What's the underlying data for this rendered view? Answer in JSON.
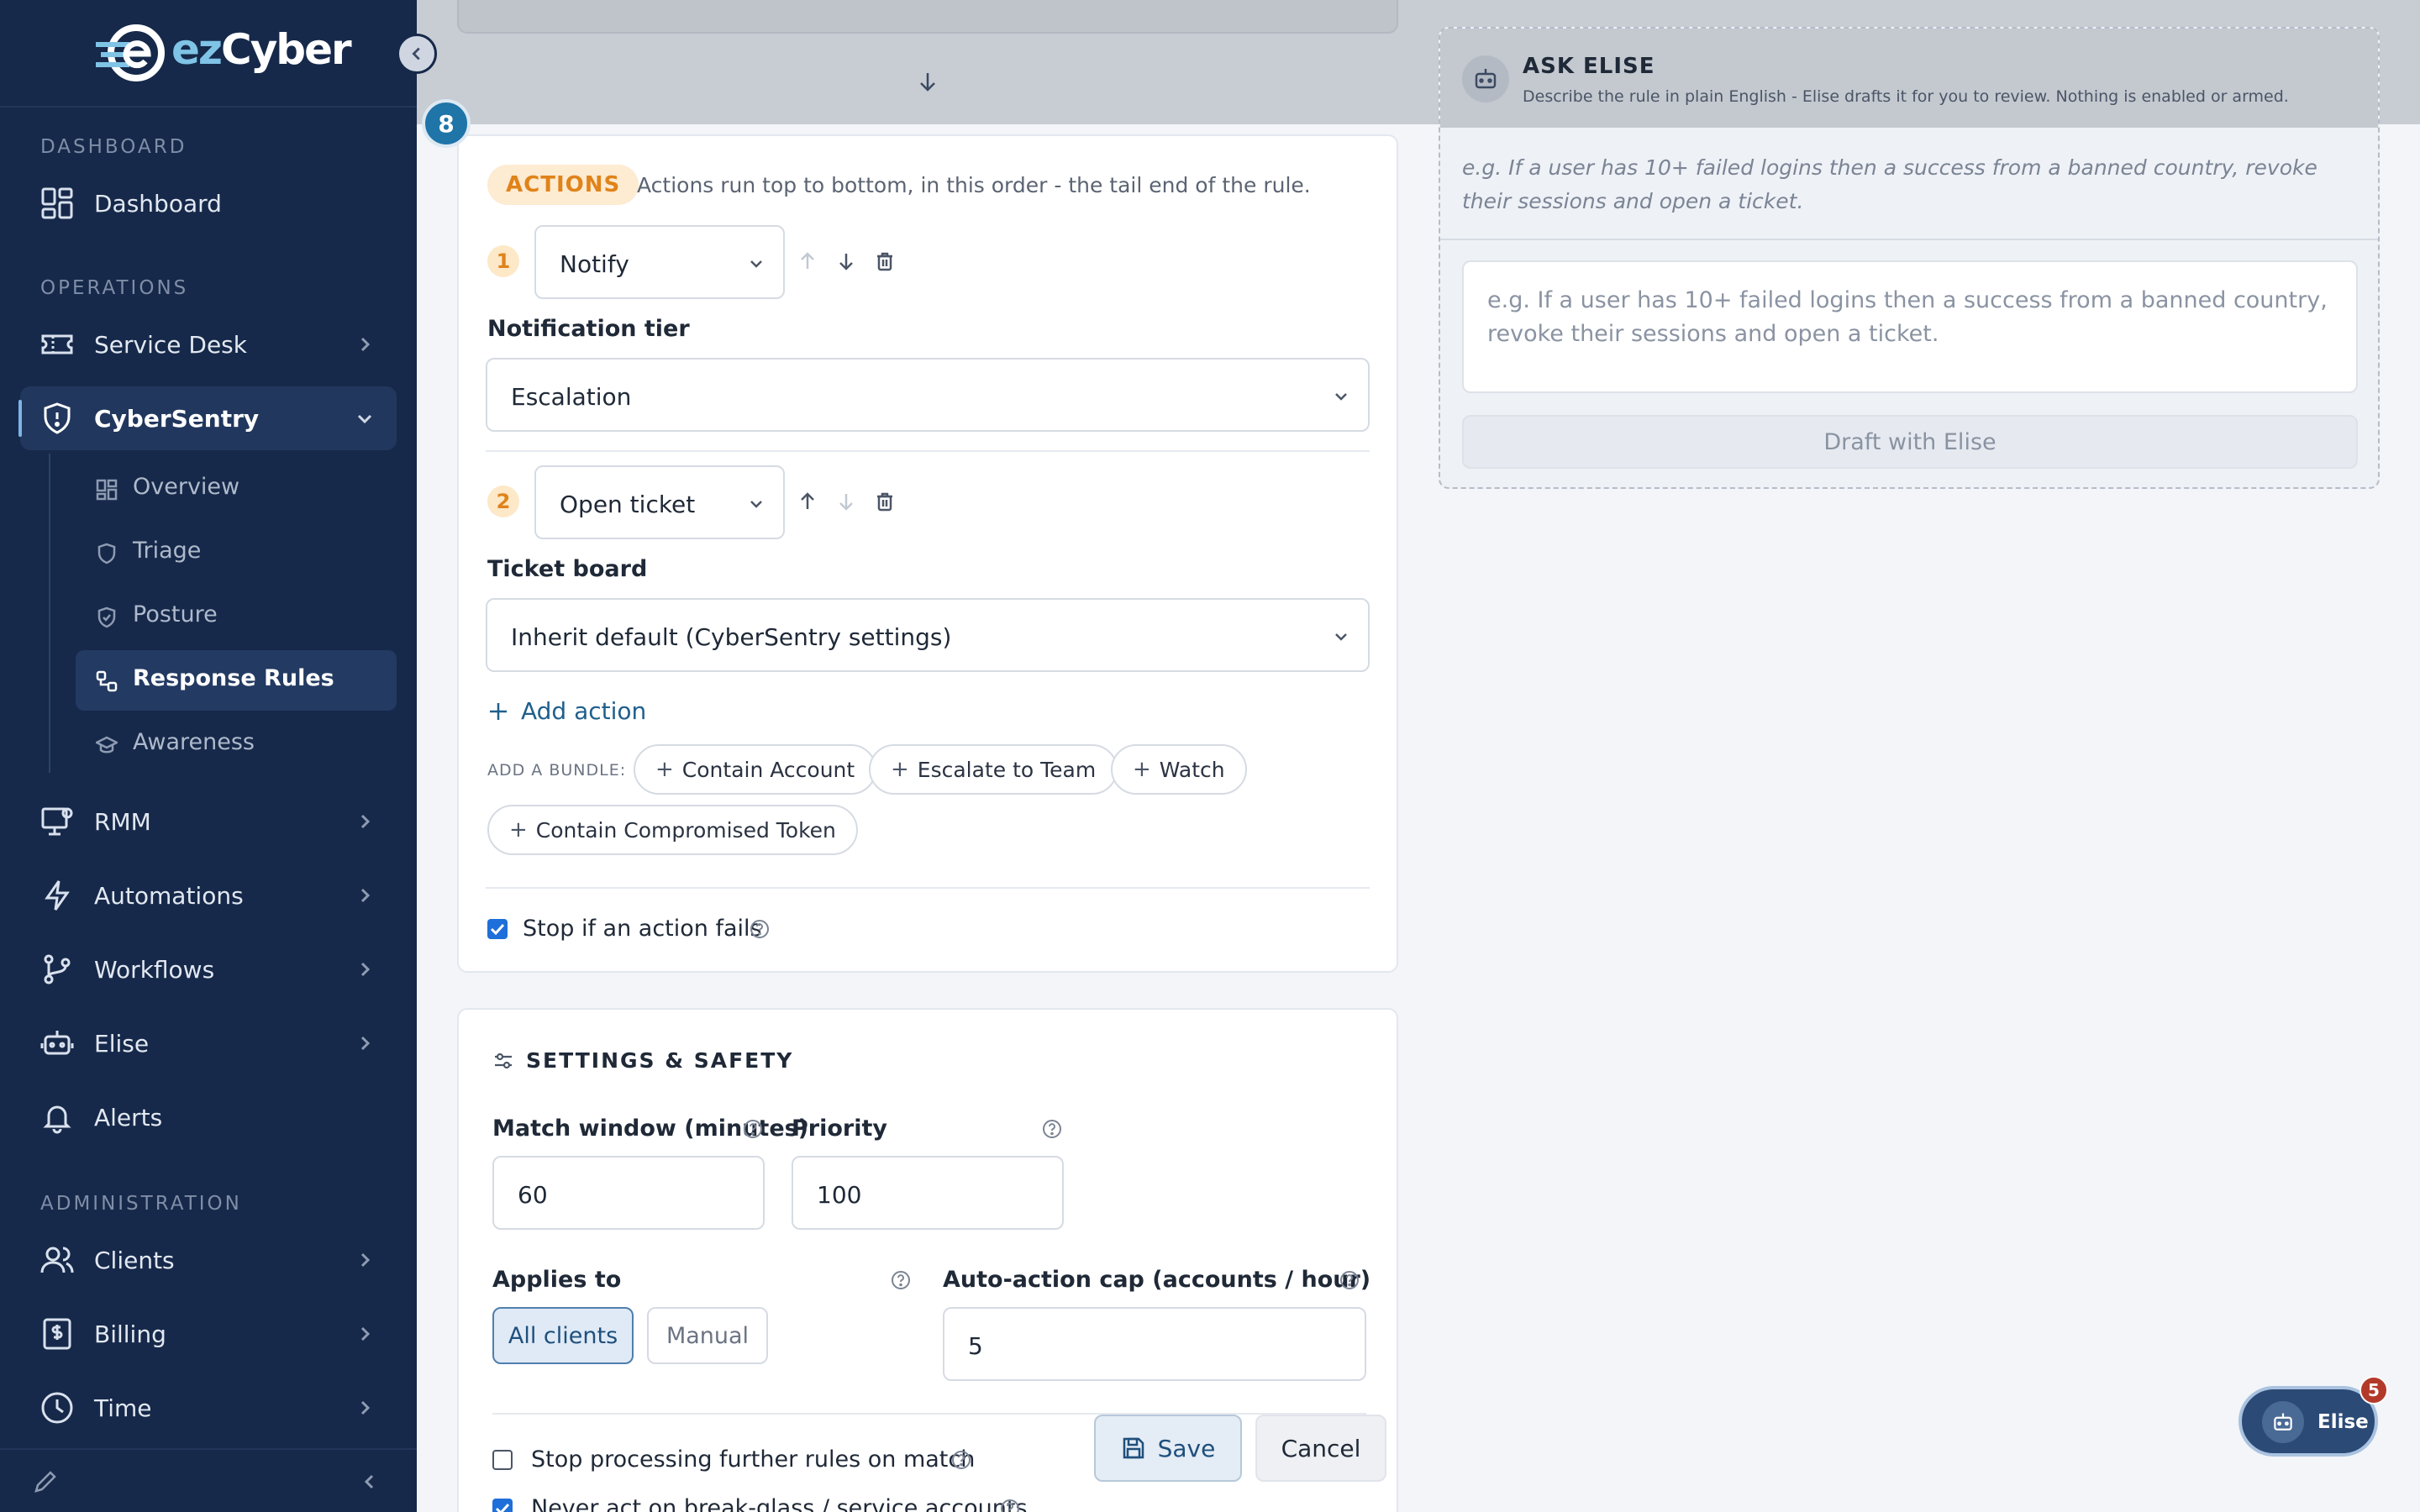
{
  "brand": {
    "name_a": "ez",
    "name_b": "Cyber"
  },
  "sidebar": {
    "sections": {
      "dashboard": "DASHBOARD",
      "operations": "OPERATIONS",
      "administration": "ADMINISTRATION"
    },
    "items": {
      "dashboard": "Dashboard",
      "service_desk": "Service Desk",
      "cybersentry": "CyberSentry",
      "rmm": "RMM",
      "automations": "Automations",
      "workflows": "Workflows",
      "elise": "Elise",
      "alerts": "Alerts",
      "clients": "Clients",
      "billing": "Billing",
      "time": "Time"
    },
    "sub_items": {
      "overview": "Overview",
      "triage": "Triage",
      "posture": "Posture",
      "response_rules": "Response Rules",
      "awareness": "Awareness"
    }
  },
  "step": {
    "number": "8"
  },
  "actions": {
    "tag": "ACTIONS",
    "description": "Actions run top to bottom, in this order - the tail end of the rule.",
    "rows": [
      {
        "index": "1",
        "type": "Notify",
        "field_label": "Notification tier",
        "field_value": "Escalation"
      },
      {
        "index": "2",
        "type": "Open ticket",
        "field_label": "Ticket board",
        "field_value": "Inherit default (CyberSentry settings)"
      }
    ],
    "add_action": "Add action",
    "bundle_label": "ADD A BUNDLE:",
    "bundles": [
      "Contain Account",
      "Escalate to Team",
      "Watch",
      "Contain Compromised Token"
    ],
    "stop_on_fail": "Stop if an action fails"
  },
  "settings": {
    "title": "SETTINGS & SAFETY",
    "match_window_label": "Match window (minutes)",
    "match_window_value": "60",
    "priority_label": "Priority",
    "priority_value": "100",
    "applies_to_label": "Applies to",
    "applies_options": [
      "All clients",
      "Manual"
    ],
    "cap_label": "Auto-action cap (accounts / hour)",
    "cap_value": "5",
    "stop_processing": "Stop processing further rules on match",
    "never_act": "Never act on break-glass / service accounts"
  },
  "buttons": {
    "save": "Save",
    "cancel": "Cancel"
  },
  "elise": {
    "title": "ASK ELISE",
    "subtitle": "Describe the rule in plain English - Elise drafts it for you to review. Nothing is enabled or armed.",
    "hint": "e.g. If a user has 10+ failed logins then a success from a banned country, revoke their sessions and open a ticket.",
    "placeholder": "e.g. If a user has 10+ failed logins then a success from a banned country, revoke their sessions and open a ticket.",
    "draft_button": "Draft with Elise"
  },
  "fab": {
    "label": "Elise",
    "badge": "5"
  },
  "colors": {
    "sidebar_bg": "#16294a",
    "accent": "#1f74a8",
    "actions_tag": "#e0831a",
    "badge": "#b33a2a"
  }
}
